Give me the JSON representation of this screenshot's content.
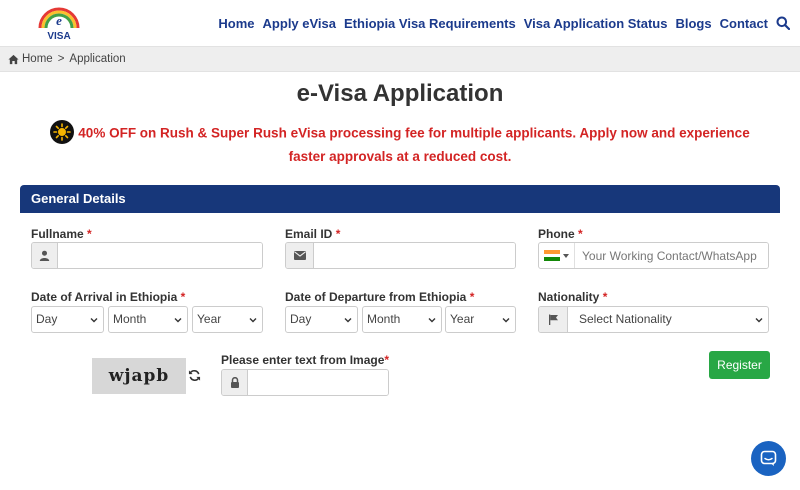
{
  "header": {
    "logo_text": "VISA",
    "logo_letter": "e",
    "nav": [
      "Home",
      "Apply eVisa",
      "Ethiopia Visa Requirements",
      "Visa Application Status",
      "Blogs",
      "Contact"
    ]
  },
  "breadcrumb": {
    "home": "Home",
    "separator": ">",
    "current": "Application"
  },
  "page_title": "e-Visa Application",
  "promo": {
    "text": "40% OFF on Rush & Super Rush eVisa processing fee for multiple applicants. Apply now and experience faster approvals at a reduced cost."
  },
  "panel": {
    "title": "General Details"
  },
  "form": {
    "fullname_label": "Fullname",
    "email_label": "Email ID",
    "phone_label": "Phone",
    "phone_placeholder": "Your Working Contact/WhatsApp Nu",
    "arrival_label": "Date of Arrival in Ethiopia",
    "departure_label": "Date of Departure from Ethiopia",
    "nationality_label": "Nationality",
    "day": "Day",
    "month": "Month",
    "year": "Year",
    "nationality_value": "Select Nationality",
    "captcha_text": "wjapb",
    "captcha_label": "Please enter text from Image",
    "required_mark": "*",
    "register": "Register"
  },
  "colors": {
    "brand_blue": "#17377a",
    "nav_link": "#1b3a8c",
    "promo_red": "#d32424",
    "register_green": "#28a745",
    "chat_blue": "#1a63c1"
  }
}
